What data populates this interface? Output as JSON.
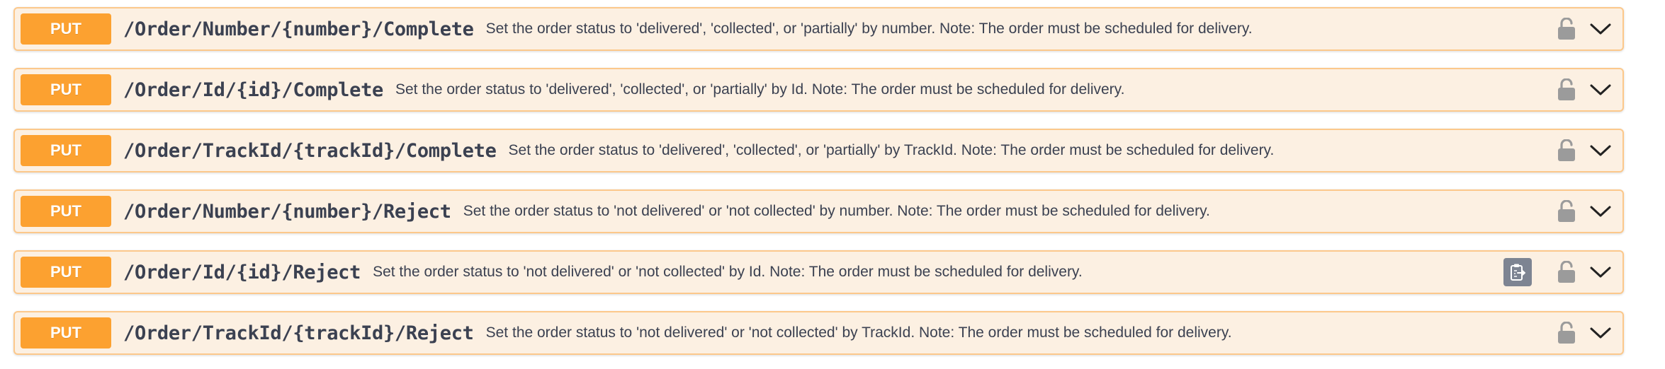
{
  "operations": [
    {
      "method": "PUT",
      "path": "/Order/Number/{number}/Complete",
      "summary": "Set the order status to 'delivered', 'collected', or 'partially' by number. Note: The order must be scheduled for delivery."
    },
    {
      "method": "PUT",
      "path": "/Order/Id/{id}/Complete",
      "summary": "Set the order status to 'delivered', 'collected', or 'partially' by Id. Note: The order must be scheduled for delivery."
    },
    {
      "method": "PUT",
      "path": "/Order/TrackId/{trackId}/Complete",
      "summary": "Set the order status to 'delivered', 'collected', or 'partially' by TrackId. Note: The order must be scheduled for delivery."
    },
    {
      "method": "PUT",
      "path": "/Order/Number/{number}/Reject",
      "summary": "Set the order status to 'not delivered' or 'not collected' by number. Note: The order must be scheduled for delivery."
    },
    {
      "method": "PUT",
      "path": "/Order/Id/{id}/Reject",
      "summary": "Set the order status to 'not delivered' or 'not collected' by Id. Note: The order must be scheduled for delivery."
    },
    {
      "method": "PUT",
      "path": "/Order/TrackId/{trackId}/Reject",
      "summary": "Set the order status to 'not delivered' or 'not collected' by TrackId. Note: The order must be scheduled for delivery."
    }
  ],
  "icons": {
    "lock": "unlocked-padlock-icon",
    "expand": "chevron-down-icon",
    "copy": "copy-to-clipboard-icon"
  },
  "colors": {
    "put_method": "#fca130",
    "block_background": "#fcf0e2",
    "block_border": "#fcc88b",
    "text": "#3b4151",
    "icon_gray": "#9b9b9b",
    "copy_button": "#7d8492"
  }
}
